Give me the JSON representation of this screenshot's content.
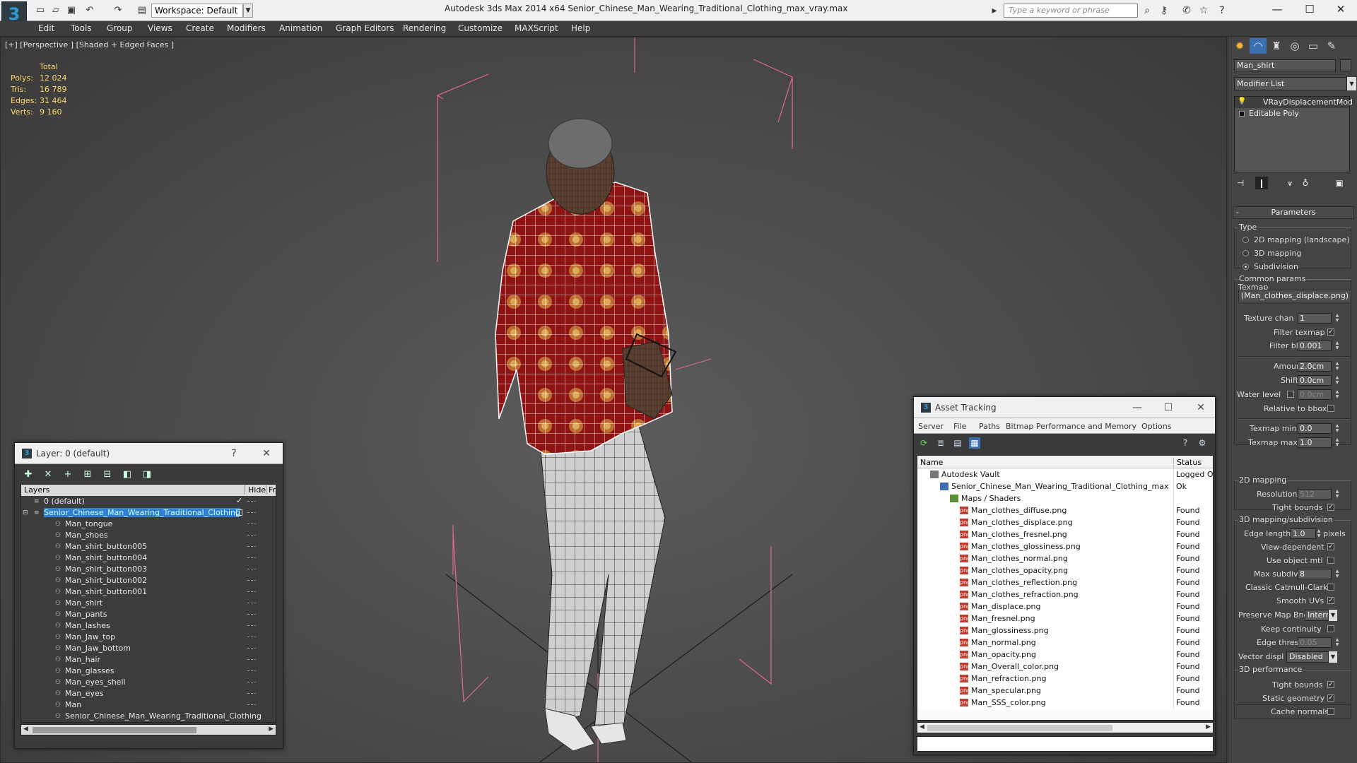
{
  "titlebar": {
    "workspace": "Workspace: Default",
    "title": "Autodesk 3ds Max  2014 x64     Senior_Chinese_Man_Wearing_Traditional_Clothing_max_vray.max",
    "search_placeholder": "Type a keyword or phrase",
    "min": "—",
    "max": "☐",
    "close": "✕",
    "help": "?"
  },
  "menubar": [
    "Edit",
    "Tools",
    "Group",
    "Views",
    "Create",
    "Modifiers",
    "Animation",
    "Graph Editors",
    "Rendering",
    "Customize",
    "MAXScript",
    "Help"
  ],
  "viewport": {
    "label": "[+] [Perspective ] [Shaded + Edged Faces ]",
    "stats": {
      "header": "Total",
      "rows": [
        {
          "k": "Polys:",
          "v": "12 024"
        },
        {
          "k": "Tris:",
          "v": "16 789"
        },
        {
          "k": "Edges:",
          "v": "31 464"
        },
        {
          "k": "Verts:",
          "v": "9 160"
        }
      ]
    }
  },
  "layerwin": {
    "title": "Layer: 0 (default)",
    "help": "?",
    "close": "✕",
    "col_layers": "Layers",
    "col_hide": "Hide",
    "col_fr": "Fr",
    "rows": [
      {
        "name": "0 (default)",
        "level": 0,
        "check": "✓"
      },
      {
        "name": "Senior_Chinese_Man_Wearing_Traditional_Clothing",
        "level": 0,
        "selected": true
      },
      {
        "name": "Man_tongue",
        "level": 1
      },
      {
        "name": "Man_shoes",
        "level": 1
      },
      {
        "name": "Man_shirt_button005",
        "level": 1
      },
      {
        "name": "Man_shirt_button004",
        "level": 1
      },
      {
        "name": "Man_shirt_button003",
        "level": 1
      },
      {
        "name": "Man_shirt_button002",
        "level": 1
      },
      {
        "name": "Man_shirt_button001",
        "level": 1
      },
      {
        "name": "Man_shirt",
        "level": 1
      },
      {
        "name": "Man_pants",
        "level": 1
      },
      {
        "name": "Man_lashes",
        "level": 1
      },
      {
        "name": "Man_Jaw_top",
        "level": 1
      },
      {
        "name": "Man_Jaw_bottom",
        "level": 1
      },
      {
        "name": "Man_hair",
        "level": 1
      },
      {
        "name": "Man_glasses",
        "level": 1
      },
      {
        "name": "Man_eyes_shell",
        "level": 1
      },
      {
        "name": "Man_eyes",
        "level": 1
      },
      {
        "name": "Man",
        "level": 1
      },
      {
        "name": "Senior_Chinese_Man_Wearing_Traditional_Clothing",
        "level": 1
      }
    ]
  },
  "assetwin": {
    "title": "Asset Tracking",
    "menu": [
      "Server",
      "File",
      "Paths",
      "Bitmap Performance and Memory",
      "Options"
    ],
    "col_name": "Name",
    "col_status": "Status",
    "rows": [
      {
        "name": "Autodesk Vault",
        "status": "Logged O",
        "icon": "vault",
        "level": 0
      },
      {
        "name": "Senior_Chinese_Man_Wearing_Traditional_Clothing_max...",
        "status": "Ok",
        "icon": "scene",
        "level": 1
      },
      {
        "name": "Maps / Shaders",
        "status": "",
        "icon": "folder",
        "level": 2
      },
      {
        "name": "Man_clothes_diffuse.png",
        "status": "Found",
        "icon": "png",
        "level": 3
      },
      {
        "name": "Man_clothes_displace.png",
        "status": "Found",
        "icon": "png",
        "level": 3
      },
      {
        "name": "Man_clothes_fresnel.png",
        "status": "Found",
        "icon": "png",
        "level": 3
      },
      {
        "name": "Man_clothes_glossiness.png",
        "status": "Found",
        "icon": "png",
        "level": 3
      },
      {
        "name": "Man_clothes_normal.png",
        "status": "Found",
        "icon": "png",
        "level": 3
      },
      {
        "name": "Man_clothes_opacity.png",
        "status": "Found",
        "icon": "png",
        "level": 3
      },
      {
        "name": "Man_clothes_reflection.png",
        "status": "Found",
        "icon": "png",
        "level": 3
      },
      {
        "name": "Man_clothes_refraction.png",
        "status": "Found",
        "icon": "png",
        "level": 3
      },
      {
        "name": "Man_displace.png",
        "status": "Found",
        "icon": "png",
        "level": 3
      },
      {
        "name": "Man_fresnel.png",
        "status": "Found",
        "icon": "png",
        "level": 3
      },
      {
        "name": "Man_glossiness.png",
        "status": "Found",
        "icon": "png",
        "level": 3
      },
      {
        "name": "Man_normal.png",
        "status": "Found",
        "icon": "png",
        "level": 3
      },
      {
        "name": "Man_opacity.png",
        "status": "Found",
        "icon": "png",
        "level": 3
      },
      {
        "name": "Man_Overall_color.png",
        "status": "Found",
        "icon": "png",
        "level": 3
      },
      {
        "name": "Man_refraction.png",
        "status": "Found",
        "icon": "png",
        "level": 3
      },
      {
        "name": "Man_specular.png",
        "status": "Found",
        "icon": "png",
        "level": 3
      },
      {
        "name": "Man_SSS_color.png",
        "status": "Found",
        "icon": "png",
        "level": 3
      }
    ]
  },
  "cmdpanel": {
    "object_name": "Man_shirt",
    "modifier_list": "Modifier List",
    "stack": [
      "VRayDisplacementMod",
      "Editable Poly"
    ],
    "params_title": "Parameters",
    "type_group": "Type",
    "type_options": [
      "2D mapping (landscape)",
      "3D mapping",
      "Subdivision"
    ],
    "type_selected": 2,
    "common_group": "Common params",
    "texmap_label": "Texmap",
    "texmap_value": "(Man_clothes_displace.png)",
    "texture_chan_label": "Texture chan",
    "texture_chan": "1",
    "filter_texmap_label": "Filter texmap",
    "filter_blur_label": "Filter blur",
    "filter_blur": "0.001",
    "amount_label": "Amount",
    "amount": "2.0cm",
    "shift_label": "Shift",
    "shift": "0.0cm",
    "water_level_label": "Water level",
    "water_level": "0.0cm",
    "relative_bbox_label": "Relative to bbox",
    "texmap_min_label": "Texmap min",
    "texmap_min": "0.0",
    "texmap_max_label": "Texmap max",
    "texmap_max": "1.0",
    "mapping2d_group": "2D mapping",
    "resolution_label": "Resolution",
    "resolution": "512",
    "tight_bounds_label": "Tight bounds",
    "mapping3d_group": "3D mapping/subdivision",
    "edge_length_label": "Edge length",
    "edge_length": "1.0",
    "pixels_label": "pixels",
    "view_dependent_label": "View-dependent",
    "use_object_mtl_label": "Use object mtl",
    "max_subdivs_label": "Max subdivs",
    "max_subdivs": "8",
    "catmull_label": "Classic Catmull-Clark",
    "smooth_uvs_label": "Smooth UVs",
    "preserve_map_label": "Preserve Map Bnd",
    "preserve_map_value": "Intern",
    "keep_continuity_label": "Keep continuity",
    "edge_thresh_label": "Edge thresh",
    "edge_thresh": "0.05",
    "vector_displ_label": "Vector displ",
    "vector_displ_value": "Disabled",
    "perf_group": "3D performance",
    "tight_bounds2_label": "Tight bounds",
    "static_geometry_label": "Static geometry",
    "cache_normals_label": "Cache normals",
    "check": "✓"
  }
}
